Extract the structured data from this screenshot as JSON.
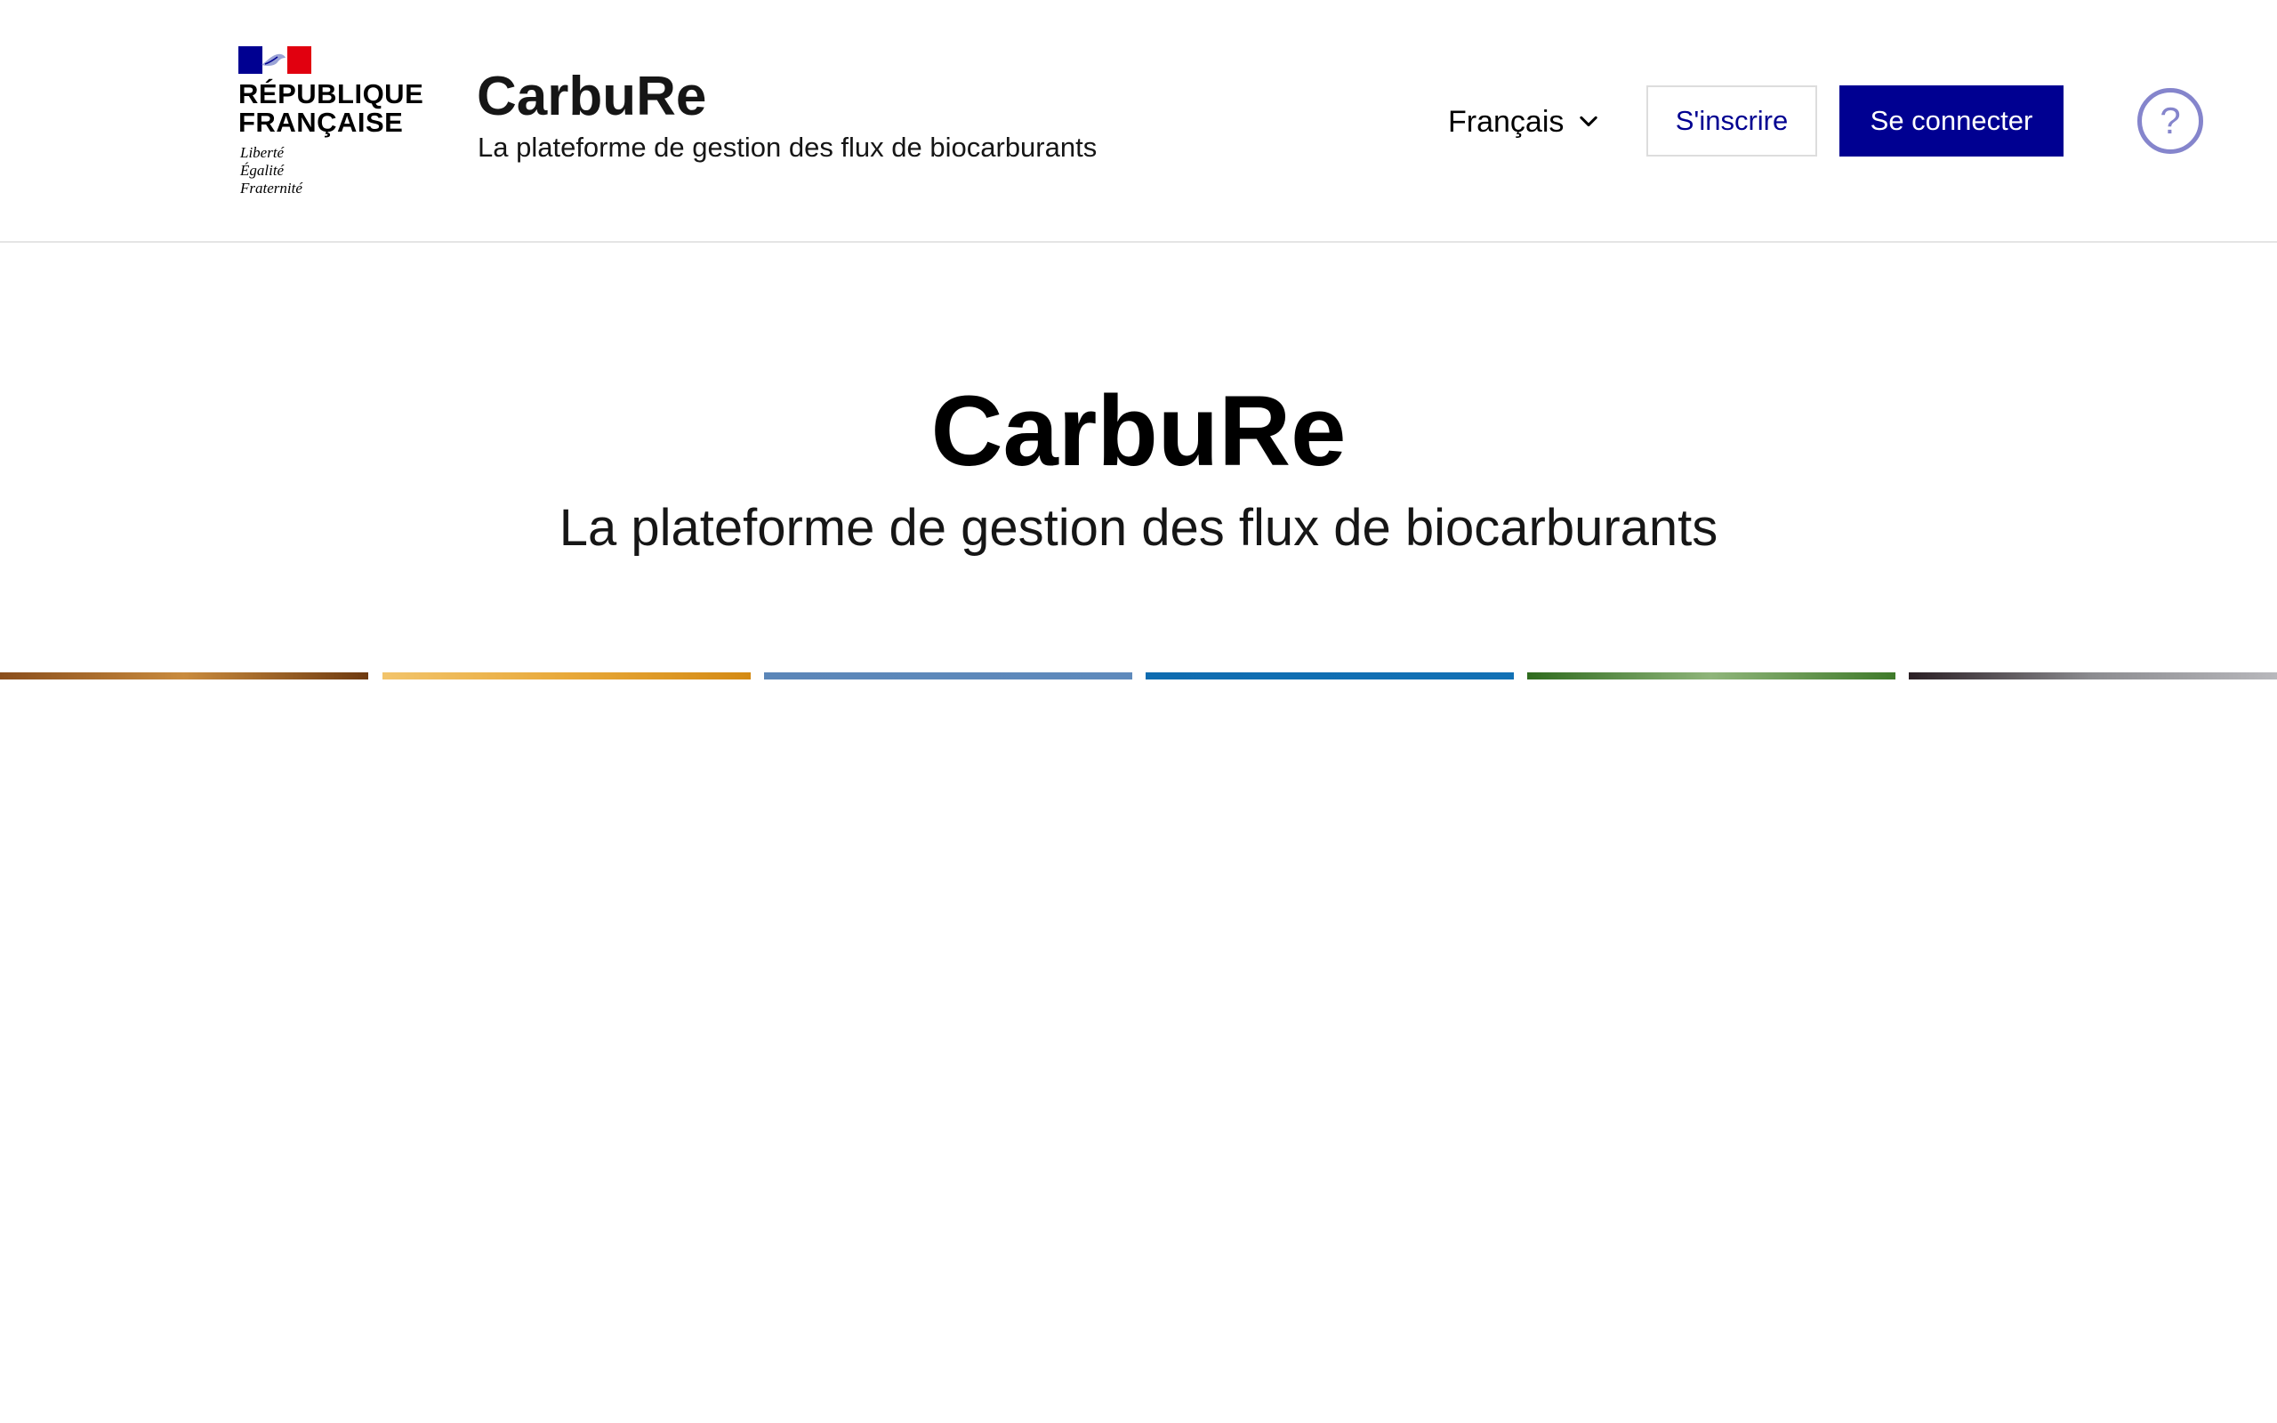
{
  "header": {
    "logo": {
      "name_lines": "RÉPUBLIQUE\nFRANÇAISE",
      "motto_lines": "Liberté\nÉgalité\nFraternité",
      "flag_colors": [
        "#000091",
        "#ffffff",
        "#e1000f"
      ]
    },
    "service_title": "CarbuRe",
    "service_tagline": "La plateforme de gestion des flux de biocarburants",
    "language": {
      "selected": "Français",
      "icon": "chevron-down-icon"
    },
    "signup_label": "S'inscrire",
    "login_label": "Se connecter",
    "help": {
      "glyph": "?",
      "icon": "help-icon"
    }
  },
  "hero": {
    "title": "CarbuRe",
    "tagline": "La plateforme de gestion des flux de biocarburants"
  },
  "image_strip": [
    {
      "name": "image-tile-1",
      "colors": [
        "#8a4e1c",
        "#c98b3e",
        "#6e3a10"
      ]
    },
    {
      "name": "image-tile-2",
      "colors": [
        "#f2c46b",
        "#e8a93a",
        "#d48a14"
      ]
    },
    {
      "name": "image-tile-3",
      "colors": [
        "#5b86b8",
        "#5f8abc"
      ]
    },
    {
      "name": "image-tile-4",
      "colors": [
        "#0f6cb0",
        "#1271b5"
      ]
    },
    {
      "name": "image-tile-5",
      "colors": [
        "#2f6b1e",
        "#8fb57a",
        "#3f7a2a"
      ]
    },
    {
      "name": "image-tile-6",
      "colors": [
        "#2a1f24",
        "#8c8c90",
        "#b8b8bc"
      ]
    }
  ],
  "colors": {
    "primary": "#000091",
    "help_accent": "#8585cc",
    "border": "#e5e5e5"
  }
}
